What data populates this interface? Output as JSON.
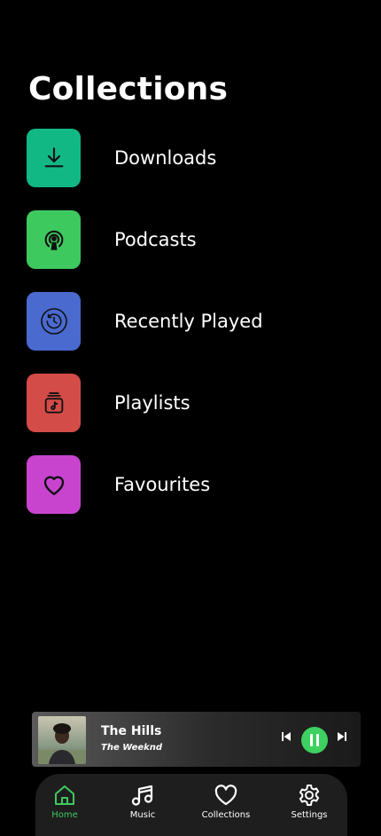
{
  "page": {
    "title": "Collections"
  },
  "collections": [
    {
      "label": "Downloads",
      "icon": "download-icon",
      "color": "#11b884"
    },
    {
      "label": "Podcasts",
      "icon": "podcast-icon",
      "color": "#3ec95f"
    },
    {
      "label": "Recently Played",
      "icon": "history-icon",
      "color": "#4a6ad0"
    },
    {
      "label": "Playlists",
      "icon": "playlist-icon",
      "color": "#d44c48"
    },
    {
      "label": "Favourites",
      "icon": "heart-icon",
      "color": "#c844cf"
    }
  ],
  "now_playing": {
    "song": "The Hills",
    "artist": "The Weeknd",
    "state": "playing",
    "accent": "#3ed060"
  },
  "tabs": [
    {
      "label": "Home",
      "icon": "home-icon",
      "active": true
    },
    {
      "label": "Music",
      "icon": "music-icon",
      "active": false
    },
    {
      "label": "Collections",
      "icon": "heart-icon",
      "active": false
    },
    {
      "label": "Settings",
      "icon": "gear-icon",
      "active": false
    }
  ]
}
